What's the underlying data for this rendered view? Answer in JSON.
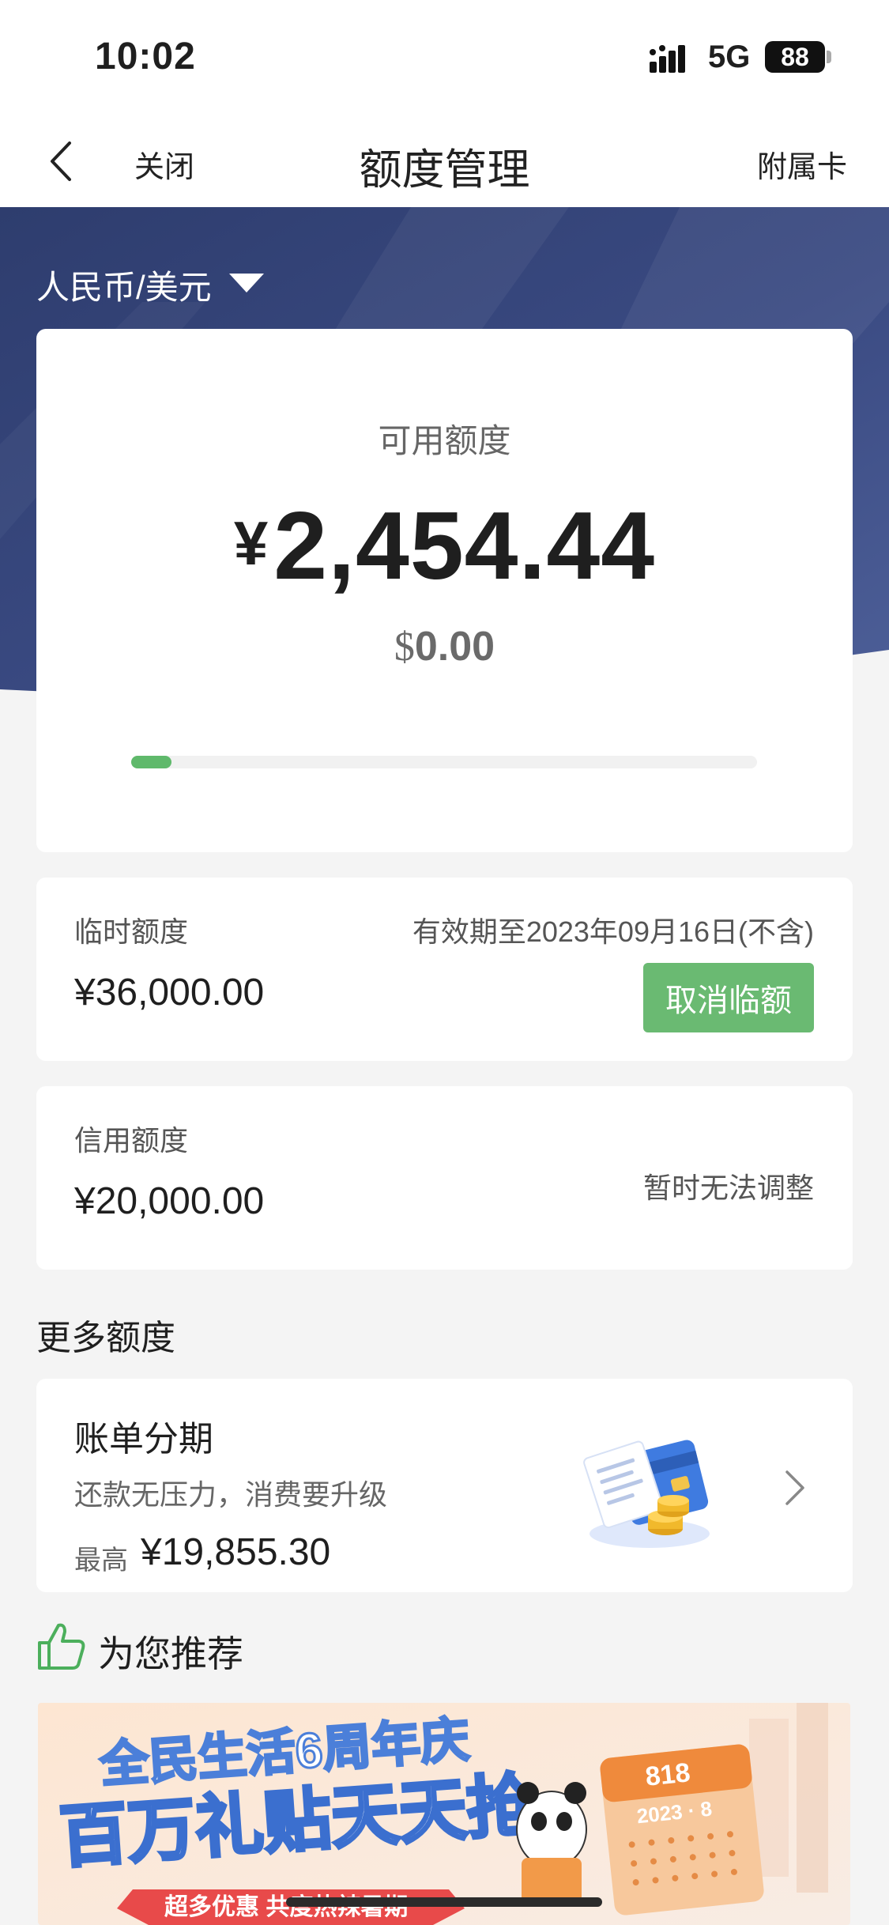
{
  "status": {
    "time": "10:02",
    "network": "5G",
    "battery": "88"
  },
  "nav": {
    "close_label": "关闭",
    "title": "额度管理",
    "right_label": "附属卡"
  },
  "currency": {
    "selected": "人民币/美元"
  },
  "available": {
    "label": "可用额度",
    "cny_symbol": "¥",
    "cny_value": "2,454.44",
    "usd_symbol": "$",
    "usd_value": "0.00",
    "progress_fraction": 0.065
  },
  "temporary": {
    "label": "临时额度",
    "validity": "有效期至2023年09月16日(不含)",
    "amount": "¥36,000.00",
    "cancel_label": "取消临额"
  },
  "credit": {
    "label": "信用额度",
    "amount": "¥20,000.00",
    "note": "暂时无法调整"
  },
  "more": {
    "title": "更多额度",
    "installment": {
      "title": "账单分期",
      "desc": "还款无压力，消费要升级",
      "max_label": "最高",
      "max_value": "¥19,855.30",
      "icon": "bill-coins-illustration"
    }
  },
  "recommend": {
    "title": "为您推荐",
    "icon": "thumbs-up-icon",
    "promo": {
      "headline1": "全民生活6周年庆",
      "headline2": "百万礼贴天天抢",
      "ribbon": "超多优惠 共度热辣暑期",
      "calendar_top": "818",
      "calendar_date": "2023 · 8"
    }
  },
  "colors": {
    "accent_green": "#6aba72",
    "banner_blue": "#34457a"
  }
}
